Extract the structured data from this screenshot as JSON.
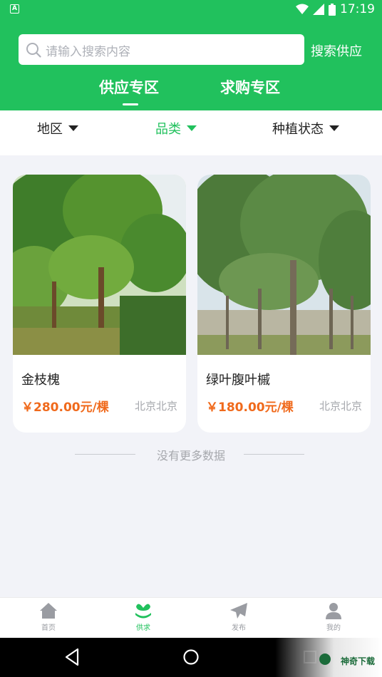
{
  "status_bar": {
    "time": "17:19",
    "left_badge": "A"
  },
  "search": {
    "placeholder": "请输入搜索内容",
    "button_label": "搜索供应"
  },
  "tabs": [
    {
      "label": "供应专区",
      "active": true
    },
    {
      "label": "求购专区",
      "active": false
    }
  ],
  "filters": [
    {
      "label": "地区",
      "active": false
    },
    {
      "label": "品类",
      "active": true
    },
    {
      "label": "种植状态",
      "active": false
    }
  ],
  "products": [
    {
      "name": "金枝槐",
      "price": "￥280.00元/棵",
      "location": "北京北京"
    },
    {
      "name": "绿叶腹叶槭",
      "price": "￥180.00元/棵",
      "location": "北京北京"
    }
  ],
  "end_text": "没有更多数据",
  "tabbar": [
    {
      "label": "首页",
      "icon": "home-icon",
      "active": false
    },
    {
      "label": "供求",
      "icon": "leaf-icon",
      "active": true
    },
    {
      "label": "发布",
      "icon": "send-icon",
      "active": false
    },
    {
      "label": "我的",
      "icon": "user-icon",
      "active": false
    }
  ],
  "watermark": "神奇下载",
  "colors": {
    "brand": "#21c15d",
    "price": "#f06a1c",
    "background": "#f2f3f8"
  }
}
